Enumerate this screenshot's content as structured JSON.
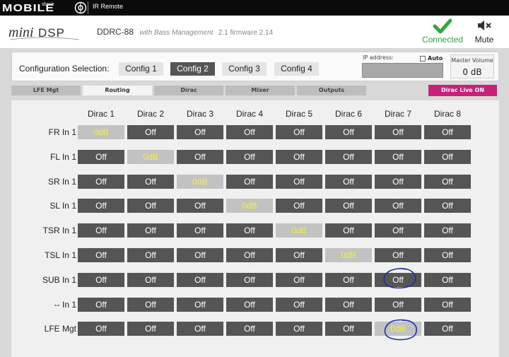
{
  "window": {
    "title": "IR Remote",
    "brand_logo": "MOBILE",
    "brand_logo_small": "store"
  },
  "header": {
    "logo": "miniDSP",
    "device_name": "DDRC-88",
    "device_subtitle": "with Bass Management",
    "firmware": "2.1 firmware 2.14",
    "status_label": "Connected",
    "status_icon": "check-icon",
    "mute_label": "Mute",
    "mute_icon": "speaker-mute-icon"
  },
  "config": {
    "label": "Configuration Selection:",
    "buttons": [
      "Config 1",
      "Config 2",
      "Config 3",
      "Config 4"
    ],
    "active_index": 1,
    "ip_label": "IP address:",
    "ip_value": "",
    "auto_label": "Auto",
    "auto_checked": false,
    "master_volume_label": "Master Volume",
    "master_volume_value": "0 dB"
  },
  "tabs": [
    "LFE Mgt",
    "Routing",
    "Dirac",
    "Mixer",
    "Outputs"
  ],
  "active_tab_index": 1,
  "dirac_live_label": "Dirac Live ON",
  "routing": {
    "columns": [
      "Dirac 1",
      "Dirac 2",
      "Dirac 3",
      "Dirac 4",
      "Dirac 5",
      "Dirac 6",
      "Dirac 7",
      "Dirac 8"
    ],
    "rows": [
      {
        "label": "FR In 1",
        "cells": [
          "0dB",
          "Off",
          "Off",
          "Off",
          "Off",
          "Off",
          "Off",
          "Off"
        ]
      },
      {
        "label": "FL In 1",
        "cells": [
          "Off",
          "0dB",
          "Off",
          "Off",
          "Off",
          "Off",
          "Off",
          "Off"
        ]
      },
      {
        "label": "SR In 1",
        "cells": [
          "Off",
          "Off",
          "0dB",
          "Off",
          "Off",
          "Off",
          "Off",
          "Off"
        ]
      },
      {
        "label": "SL In 1",
        "cells": [
          "Off",
          "Off",
          "Off",
          "0dB",
          "Off",
          "Off",
          "Off",
          "Off"
        ]
      },
      {
        "label": "TSR In 1",
        "cells": [
          "Off",
          "Off",
          "Off",
          "Off",
          "0dB",
          "Off",
          "Off",
          "Off"
        ]
      },
      {
        "label": "TSL In 1",
        "cells": [
          "Off",
          "Off",
          "Off",
          "Off",
          "Off",
          "0dB",
          "Off",
          "Off"
        ]
      },
      {
        "label": "SUB In 1",
        "cells": [
          "Off",
          "Off",
          "Off",
          "Off",
          "Off",
          "Off",
          "Off",
          "Off"
        ]
      },
      {
        "label": "-- In 1",
        "cells": [
          "Off",
          "Off",
          "Off",
          "Off",
          "Off",
          "Off",
          "Off",
          "Off"
        ]
      },
      {
        "label": "LFE Mgt",
        "cells": [
          "Off",
          "Off",
          "Off",
          "Off",
          "Off",
          "Off",
          "0dB",
          "Off"
        ]
      }
    ],
    "on_value": "0dB"
  },
  "colors": {
    "cell_off_bg": "#555555",
    "cell_on_bg": "#c2c2c2",
    "cell_on_text": "#f5ef3a",
    "connected_green": "#2eaa3c",
    "dirac_live_bg": "#cc1f7a",
    "annotation_ink": "#1b2fa8"
  }
}
